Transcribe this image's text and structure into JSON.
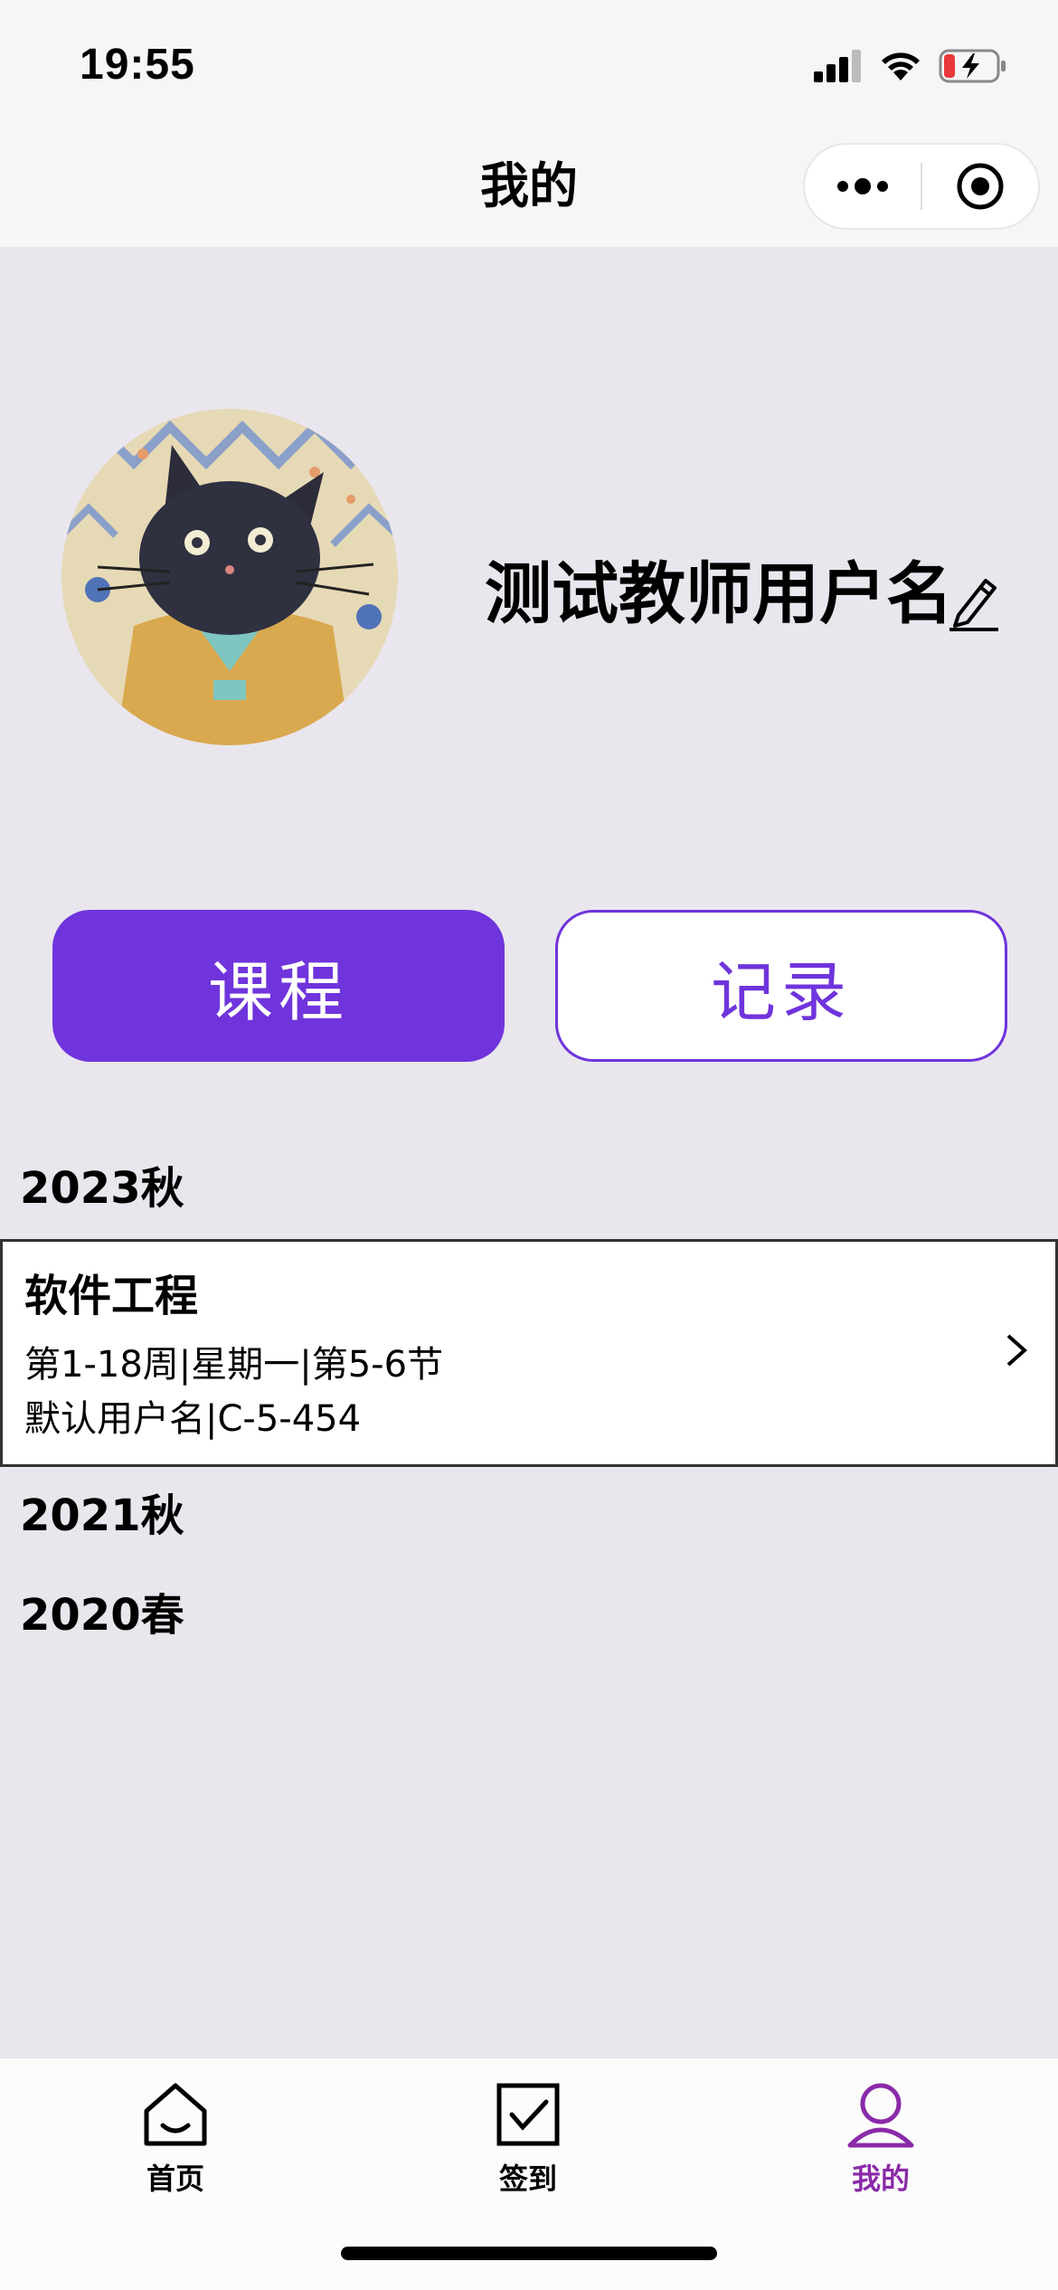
{
  "status_bar": {
    "time": "19:55"
  },
  "header": {
    "title": "我的"
  },
  "profile": {
    "username": "测试教师用户名"
  },
  "buttons": {
    "course": "课程",
    "record": "记录"
  },
  "semesters": [
    {
      "label": "2023秋",
      "courses": [
        {
          "name": "软件工程",
          "schedule": "第1-18周|星期一|第5-6节",
          "detail": "默认用户名|C-5-454"
        }
      ]
    },
    {
      "label": "2021秋",
      "courses": []
    },
    {
      "label": "2020春",
      "courses": []
    }
  ],
  "tabbar": {
    "items": [
      {
        "label": "首页",
        "icon": "home-icon",
        "active": false
      },
      {
        "label": "签到",
        "icon": "checkin-icon",
        "active": false
      },
      {
        "label": "我的",
        "icon": "profile-icon",
        "active": true
      }
    ]
  },
  "colors": {
    "accent": "#6f34dc",
    "background": "#e9e6ee",
    "header_bg": "#f6f6f6",
    "tab_active": "#8a2aa8"
  }
}
